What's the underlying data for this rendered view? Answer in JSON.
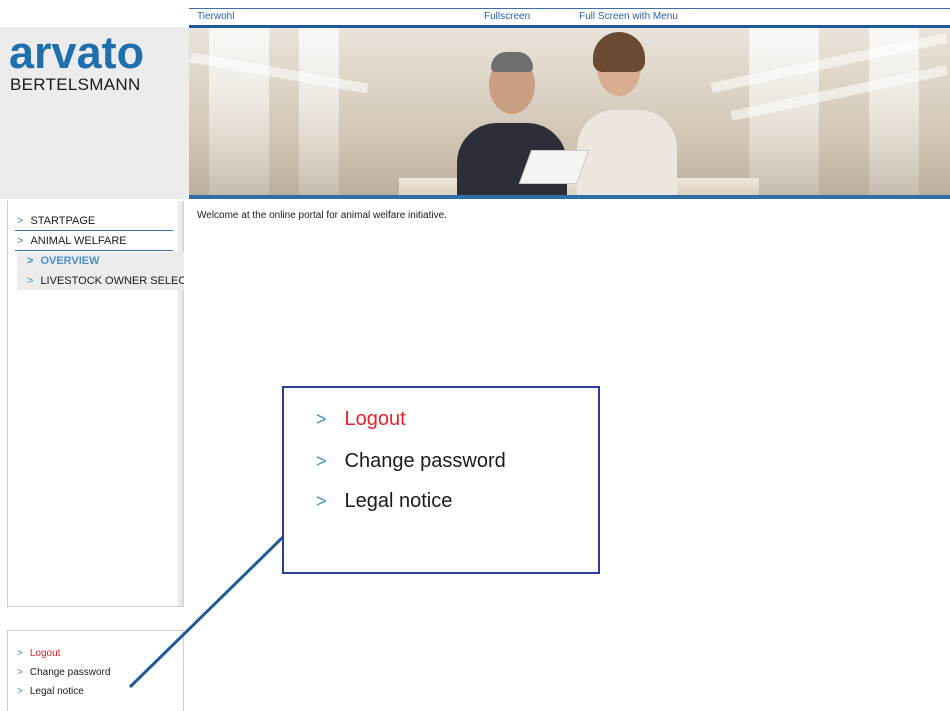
{
  "top_links": {
    "tierwohl": "Tierwohl",
    "fullscreen": "Fullscreen",
    "fullscreen_menu": "Full Screen with Menu"
  },
  "logo": {
    "primary": "arvato",
    "secondary": "BERTELSMANN"
  },
  "sidebar": {
    "items": [
      {
        "label": "STARTPAGE"
      },
      {
        "label": "ANIMAL WELFARE"
      },
      {
        "label": "OVERVIEW"
      },
      {
        "label": "LIVESTOCK OWNER SELECTION"
      }
    ]
  },
  "bottom_nav": {
    "logout": "Logout",
    "change_password": "Change password",
    "legal_notice": "Legal notice"
  },
  "main": {
    "welcome": "Welcome at the online portal for animal welfare initiative."
  },
  "colors": {
    "brand_blue": "#1f6fae",
    "logout_red": "#d8232a",
    "active_item": "#4d8fc8",
    "callout_border": "#2b3b9e"
  },
  "icons": {
    "chevron": "chevron-right-icon"
  }
}
